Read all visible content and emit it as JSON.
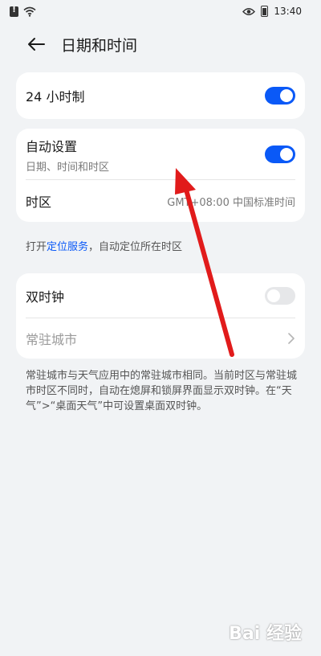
{
  "status_bar": {
    "time": "13:40"
  },
  "header": {
    "title": "日期和时间"
  },
  "card1": {
    "label_24h": "24 小时制",
    "toggle_24h_on": true
  },
  "card2": {
    "auto_label": "自动设置",
    "auto_sub": "日期、时间和时区",
    "auto_on": true,
    "timezone_label": "时区",
    "timezone_value": "GMT+08:00 中国标准时间"
  },
  "location_hint": {
    "prefix": "打开",
    "link": "定位服务",
    "suffix": "，自动定位所在时区"
  },
  "card3": {
    "dual_label": "双时钟",
    "dual_on": false,
    "city_label": "常驻城市"
  },
  "dual_hint": "常驻城市与天气应用中的常驻城市相同。当前时区与常驻城市时区不同时，自动在熄屏和锁屏界面显示双时钟。在“天气”>“桌面天气”中可设置桌面双时钟。",
  "watermark": "Bai 经验",
  "colors": {
    "accent": "#0a59f7",
    "arrow": "#e11b1b"
  }
}
